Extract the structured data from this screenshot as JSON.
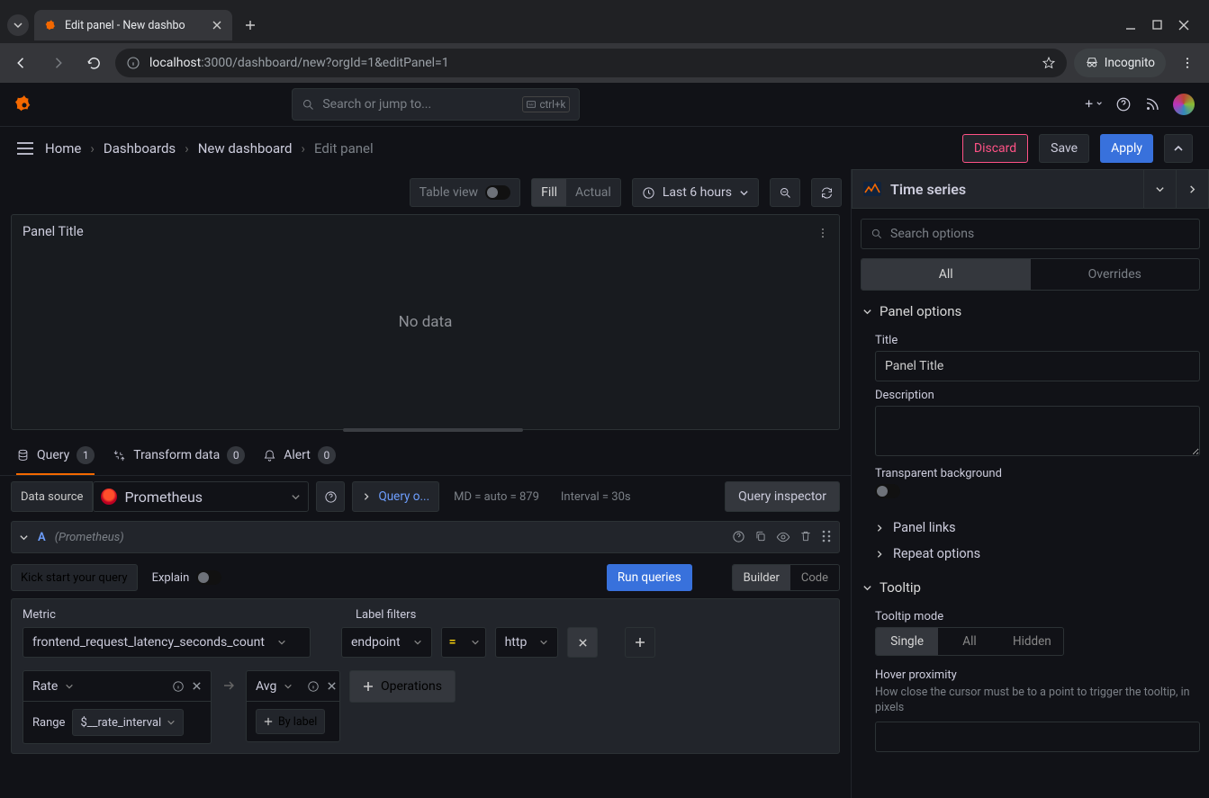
{
  "browser": {
    "tab_title": "Edit panel - New dashbo",
    "url_host": "localhost",
    "url_path": ":3000/dashboard/new?orgId=1&editPanel=1",
    "incognito_label": "Incognito"
  },
  "header": {
    "search_placeholder": "Search or jump to...",
    "kbd_hint": "ctrl+k"
  },
  "breadcrumb": {
    "home": "Home",
    "dash": "Dashboards",
    "newdash": "New dashboard",
    "edit": "Edit panel"
  },
  "actions": {
    "discard": "Discard",
    "save": "Save",
    "apply": "Apply"
  },
  "preview_toolbar": {
    "table_view": "Table view",
    "fill": "Fill",
    "actual": "Actual",
    "time_range": "Last 6 hours"
  },
  "panel": {
    "title": "Panel Title",
    "no_data": "No data"
  },
  "tabs": {
    "query": "Query",
    "query_count": "1",
    "transform": "Transform data",
    "transform_count": "0",
    "alert": "Alert",
    "alert_count": "0"
  },
  "ds": {
    "label": "Data source",
    "name": "Prometheus",
    "query_options": "Query o...",
    "md": "MD = auto = 879",
    "interval": "Interval = 30s",
    "inspector": "Query inspector"
  },
  "q": {
    "name": "A",
    "src": "(Prometheus)",
    "kick": "Kick start your query",
    "explain": "Explain",
    "run": "Run queries",
    "builder": "Builder",
    "code": "Code",
    "metric_label": "Metric",
    "labelfilters_label": "Label filters",
    "metric_value": "frontend_request_latency_seconds_count",
    "lf_key": "endpoint",
    "lf_op": "=",
    "lf_val": "http",
    "op_rate": "Rate",
    "op_range_label": "Range",
    "op_range_value": "$__rate_interval",
    "op_avg": "Avg",
    "by_label": "By label",
    "add_ops": "Operations"
  },
  "right": {
    "viz_name": "Time series",
    "search_placeholder": "Search options",
    "tab_all": "All",
    "tab_overrides": "Overrides",
    "panel_options": "Panel options",
    "title_label": "Title",
    "title_value": "Panel Title",
    "desc_label": "Description",
    "transparent_label": "Transparent background",
    "panel_links": "Panel links",
    "repeat_options": "Repeat options",
    "tooltip_h": "Tooltip",
    "tooltip_mode_label": "Tooltip mode",
    "tt_single": "Single",
    "tt_all": "All",
    "tt_hidden": "Hidden",
    "hover_prox_h": "Hover proximity",
    "hover_prox_desc": "How close the cursor must be to a point to trigger the tooltip, in pixels"
  }
}
